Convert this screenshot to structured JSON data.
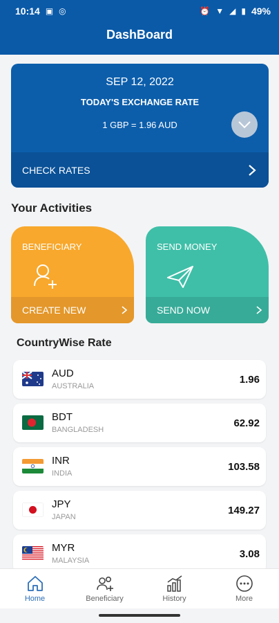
{
  "status_bar": {
    "time": "10:14",
    "battery": "49%",
    "icons": [
      "photo-icon",
      "sync-icon",
      "alarm-icon",
      "wifi-icon",
      "signal-icon",
      "battery-icon"
    ]
  },
  "app_bar": {
    "title": "DashBoard"
  },
  "exchange_card": {
    "date": "SEP 12, 2022",
    "subtitle": "TODAY'S EXCHANGE RATE",
    "rate_text": "1 GBP = 1.96 AUD",
    "check_label": "CHECK RATES"
  },
  "activities": {
    "title": "Your Activities",
    "beneficiary": {
      "title": "BENEFICIARY",
      "action": "CREATE NEW",
      "color": "#f8a82c"
    },
    "send_money": {
      "title": "SEND MONEY",
      "action": "SEND NOW",
      "color": "#3fbfa8"
    }
  },
  "country_rates": {
    "title": "CountryWise Rate",
    "items": [
      {
        "code": "AUD",
        "country": "AUSTRALIA",
        "value": "1.96",
        "flag": "australia-flag-icon"
      },
      {
        "code": "BDT",
        "country": "BANGLADESH",
        "value": "62.92",
        "flag": "bangladesh-flag-icon"
      },
      {
        "code": "INR",
        "country": "INDIA",
        "value": "103.58",
        "flag": "india-flag-icon"
      },
      {
        "code": "JPY",
        "country": "JAPAN",
        "value": "149.27",
        "flag": "japan-flag-icon"
      },
      {
        "code": "MYR",
        "country": "MALAYSIA",
        "value": "3.08",
        "flag": "malaysia-flag-icon"
      }
    ]
  },
  "bottom_nav": {
    "items": [
      {
        "label": "Home",
        "icon": "home-icon",
        "active": true
      },
      {
        "label": "Beneficiary",
        "icon": "beneficiary-icon",
        "active": false
      },
      {
        "label": "History",
        "icon": "history-icon",
        "active": false
      },
      {
        "label": "More",
        "icon": "more-icon",
        "active": false
      }
    ]
  },
  "colors": {
    "primary": "#0a5aa8",
    "accent_orange": "#f8a82c",
    "accent_green": "#3fbfa8",
    "nav_active": "#2d6fb8"
  }
}
